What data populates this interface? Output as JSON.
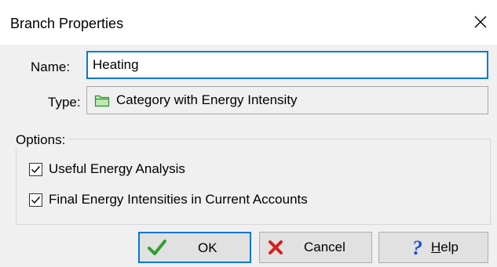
{
  "window": {
    "title": "Branch Properties"
  },
  "form": {
    "name_label": "Name:",
    "name_value": "Heating",
    "type_label": "Type:",
    "type_value": "Category with Energy Intensity",
    "type_icon": "green-folder-icon"
  },
  "options": {
    "legend": "Options:",
    "items": [
      {
        "label": "Useful Energy Analysis",
        "checked": true
      },
      {
        "label": "Final Energy Intensities in Current Accounts",
        "checked": true
      }
    ]
  },
  "buttons": {
    "ok": {
      "label": "OK",
      "icon": "green-checkmark-icon"
    },
    "cancel": {
      "label": "Cancel",
      "icon": "red-x-icon"
    },
    "help": {
      "label_prefix": "",
      "label_accel": "H",
      "label_rest": "elp",
      "icon": "blue-question-icon"
    }
  },
  "colors": {
    "accent": "#0078d7",
    "ok_icon": "#2e9e2e",
    "cancel_icon": "#d42020",
    "help_icon": "#1a4fd0",
    "folder_icon": "#3cb043"
  }
}
